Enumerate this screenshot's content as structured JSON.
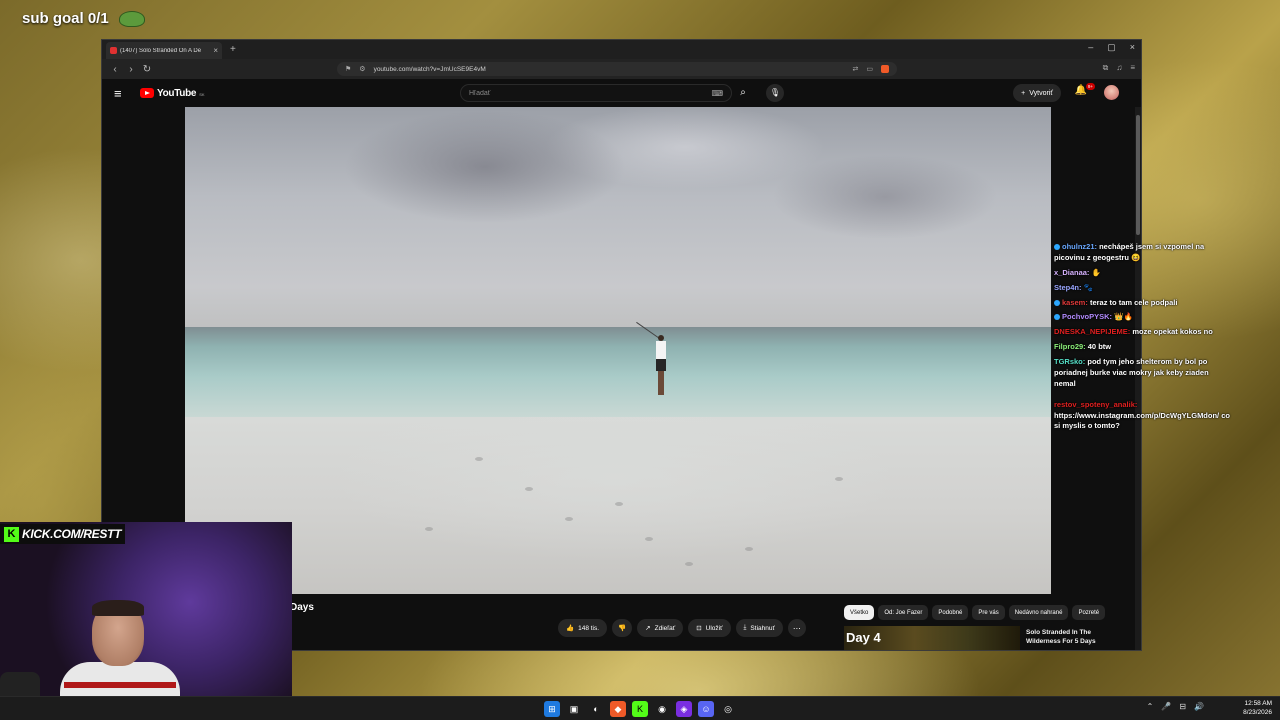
{
  "overlay": {
    "sub_goal": "sub goal 0/1",
    "kick_url": "KICK.COM/RESTT"
  },
  "browser": {
    "tab_title": "(1407) Solo Stranded On A De",
    "tab_close": "×",
    "new_tab": "+",
    "url": "youtube.com/watch?v=JmUcSE9E4vM",
    "window_controls": [
      "–",
      "▢",
      "×"
    ]
  },
  "youtube": {
    "brand": "YouTube",
    "country": "SK",
    "search_placeholder": "Hľadať",
    "create_label": "Vytvoriť",
    "notification_count": "9+",
    "video_title_partial": "Days",
    "actions": {
      "likes": "148 tis.",
      "share": "Zdieľať",
      "save": "Uložiť",
      "download": "Stiahnuť"
    },
    "chips": [
      "Všetko",
      "Od: Joe Fazer",
      "Podobné",
      "Pre vás",
      "Nedávno nahrané",
      "Pozreté"
    ],
    "recommendation": {
      "thumb_text": "Day 4",
      "title": "Solo Stranded In The Wilderness For 5 Days"
    }
  },
  "chat": [
    {
      "user": "ohulnz21:",
      "user_color": "#6aa8ff",
      "text": "nechápeš jsem si vzpomel na picovinu z geogestru 😆"
    },
    {
      "user": "x_Dianaa:",
      "user_color": "#d7b3ff",
      "text": "✋"
    },
    {
      "user": "Step4n:",
      "user_color": "#9aa6ff",
      "text": "🐾"
    },
    {
      "user": "kasem:",
      "user_color": "#e03a3a",
      "text": "teraz to tam cele podpali"
    },
    {
      "user": "PochvoPYSK:",
      "user_color": "#b48cff",
      "text": "👑🔥"
    },
    {
      "user": "DNESKA_NEPIJEME:",
      "user_color": "#e02020",
      "text": "moze opekat kokos no"
    },
    {
      "user": "Filpro29:",
      "user_color": "#8df07a",
      "text": "40 btw"
    },
    {
      "user": "TGRsko:",
      "user_color": "#56e0c8",
      "text": "pod tym jeho shelterom by bol po poriadnej burke viac mokry jak keby ziaden nemal"
    },
    {
      "user": "restov_spoteny_analik:",
      "user_color": "#e02020",
      "text": "https://www.instagram.com/p/DcWgYLGMdon/ co si myslis o tomto?"
    }
  ],
  "taskbar": {
    "time": "12:58 AM",
    "date": "8/23/2026"
  },
  "colors": {
    "yt_red": "#ff0000",
    "kick_green": "#53fc18",
    "yt_bg": "#0f0f0f"
  }
}
